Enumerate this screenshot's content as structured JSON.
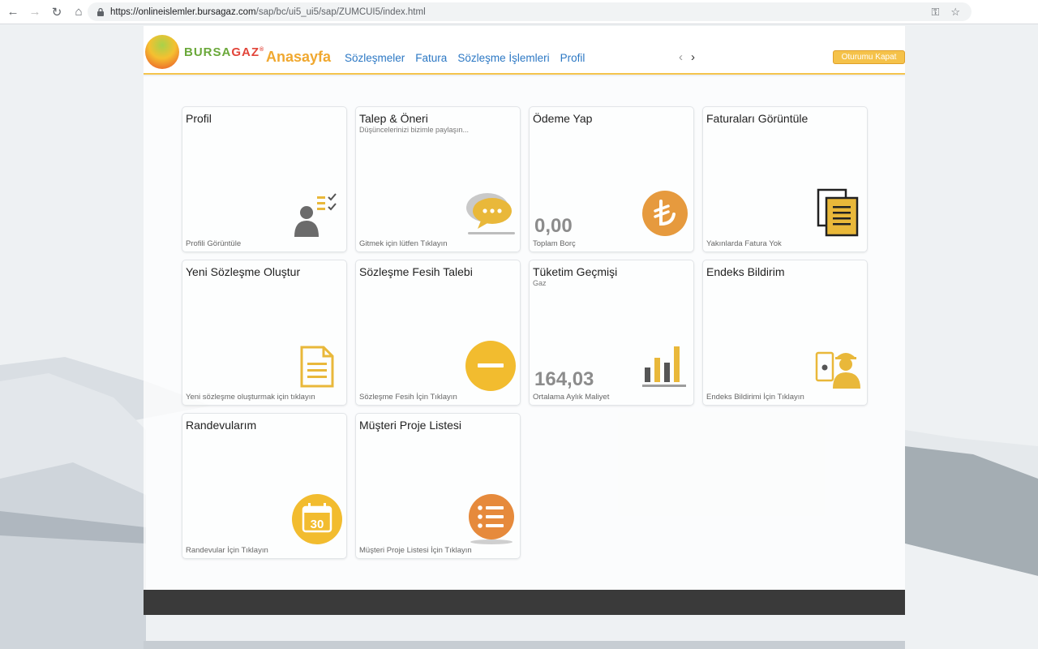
{
  "browser": {
    "url_host": "https://onlineislemler.bursagaz.com",
    "url_path": "/sap/bc/ui5_ui5/sap/ZUMCUI5/index.html"
  },
  "header": {
    "logo_text_1": "BURSA",
    "logo_text_2": "GAZ",
    "logo_mark": "®",
    "title": "Anasayfa",
    "nav": [
      "Sözleşmeler",
      "Fatura",
      "Sözleşme İşlemleri",
      "Profil"
    ],
    "logout_label": "Oturumu Kapat"
  },
  "tiles": [
    {
      "title": "Profil",
      "subtitle": "",
      "number": "",
      "footer": "Profili Görüntüle",
      "icon": "profile-check-icon"
    },
    {
      "title": "Talep & Öneri",
      "subtitle": "Düşüncelerinizi bizimle paylaşın...",
      "number": "",
      "footer": "Gitmek için lütfen Tıklayın",
      "icon": "chat-bubbles-icon"
    },
    {
      "title": "Ödeme Yap",
      "subtitle": "",
      "number": "0,00",
      "footer": "Toplam Borç",
      "icon": "lira-icon"
    },
    {
      "title": "Faturaları Görüntüle",
      "subtitle": "",
      "number": "",
      "footer": "Yakınlarda Fatura Yok",
      "icon": "invoice-icon"
    },
    {
      "title": "Yeni Sözleşme Oluştur",
      "subtitle": "",
      "number": "",
      "footer": "Yeni sözleşme oluşturmak için tıklayın",
      "icon": "document-icon"
    },
    {
      "title": "Sözleşme Fesih Talebi",
      "subtitle": "",
      "number": "",
      "footer": "Sözleşme Fesih İçin Tıklayın",
      "icon": "minus-circle-icon"
    },
    {
      "title": "Tüketim Geçmişi",
      "subtitle": "Gaz",
      "number": "164,03",
      "footer": "Ortalama Aylık Maliyet",
      "icon": "bar-chart-icon"
    },
    {
      "title": "Endeks Bildirim",
      "subtitle": "",
      "number": "",
      "footer": "Endeks Bildirimi İçin Tıklayın",
      "icon": "worker-icon"
    },
    {
      "title": "Randevularım",
      "subtitle": "",
      "number": "",
      "footer": "Randevular İçin Tıklayın",
      "icon": "calendar-icon"
    },
    {
      "title": "Müşteri Proje Listesi",
      "subtitle": "",
      "number": "",
      "footer": "Müşteri Proje Listesi İçin Tıklayın",
      "icon": "list-icon"
    }
  ],
  "calendar_day": "30",
  "colors": {
    "accent": "#f0a830",
    "link": "#2c78c4",
    "icon_gold": "#e9b83a",
    "icon_orange": "#e69a3e"
  }
}
